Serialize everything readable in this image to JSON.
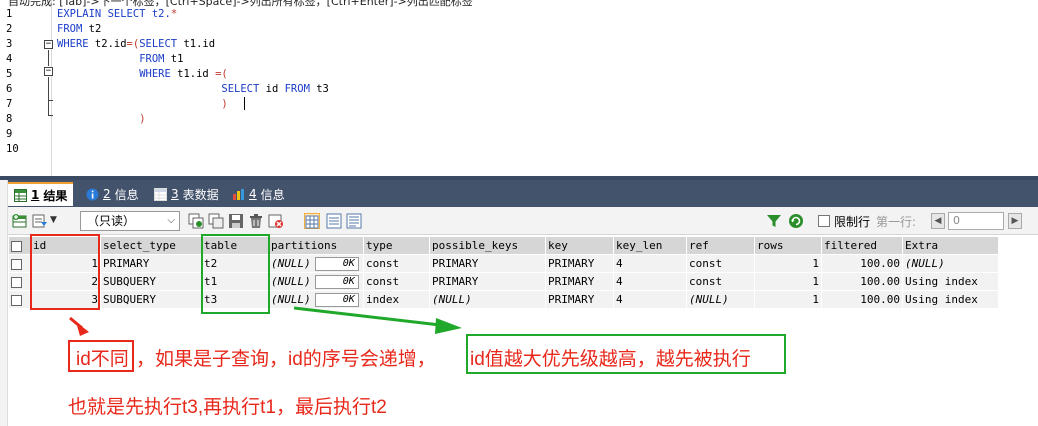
{
  "editor": {
    "hint": "自动完成: [Tab]->下一个标签，[Ctrl+Space]->列出所有标签，[Ctrl+Enter]->列出匹配标签",
    "lines": [
      {
        "no": "1",
        "indent": "",
        "tokens": [
          {
            "t": "EXPLAIN SELECT",
            "k": "kw"
          },
          {
            "t": " t2.",
            "k": "kw"
          },
          {
            "t": "*",
            "k": "pk"
          }
        ]
      },
      {
        "no": "2",
        "indent": "",
        "tokens": [
          {
            "t": "FROM",
            "k": "kw"
          },
          {
            "t": " t2",
            "k": ""
          }
        ]
      },
      {
        "no": "3",
        "indent": "",
        "tokens": [
          {
            "t": "WHERE",
            "k": "kw"
          },
          {
            "t": " t2.id",
            "k": ""
          },
          {
            "t": "=(",
            "k": "pk"
          },
          {
            "t": "SELECT",
            "k": "kw"
          },
          {
            "t": " t1.id",
            "k": ""
          }
        ]
      },
      {
        "no": "4",
        "indent": "             ",
        "tokens": [
          {
            "t": "FROM",
            "k": "kw"
          },
          {
            "t": " t1",
            "k": ""
          }
        ]
      },
      {
        "no": "5",
        "indent": "             ",
        "tokens": [
          {
            "t": "WHERE",
            "k": "kw"
          },
          {
            "t": " t1.id ",
            "k": ""
          },
          {
            "t": "=(",
            "k": "pk"
          }
        ]
      },
      {
        "no": "6",
        "indent": "                          ",
        "tokens": [
          {
            "t": "SELECT",
            "k": "kw"
          },
          {
            "t": " id ",
            "k": ""
          },
          {
            "t": "FROM",
            "k": "kw"
          },
          {
            "t": " t3",
            "k": ""
          }
        ]
      },
      {
        "no": "7",
        "indent": "                          ",
        "tokens": [
          {
            "t": ")",
            "k": "pk"
          }
        ]
      },
      {
        "no": "8",
        "indent": "             ",
        "tokens": [
          {
            "t": ")",
            "k": "pk"
          }
        ]
      },
      {
        "no": "9",
        "indent": "",
        "tokens": []
      },
      {
        "no": "10",
        "indent": "",
        "tokens": []
      }
    ]
  },
  "tabs": [
    {
      "num": "1",
      "label": "结果"
    },
    {
      "num": "2",
      "label": "信息"
    },
    {
      "num": "3",
      "label": "表数据"
    },
    {
      "num": "4",
      "label": "信息"
    }
  ],
  "toolbar": {
    "readonly_select": "（只读）",
    "limit_label": "限制行",
    "first_row_label": "第一行:",
    "first_row_value": "0"
  },
  "grid": {
    "columns": [
      "id",
      "select_type",
      "table",
      "partitions",
      "type",
      "possible_keys",
      "key",
      "key_len",
      "ref",
      "rows",
      "filtered",
      "Extra"
    ],
    "rows": [
      {
        "id": "1",
        "select_type": "PRIMARY",
        "table": "t2",
        "partitions": "(NULL)",
        "partitions_val": "0K",
        "type": "const",
        "possible_keys": "PRIMARY",
        "key": "PRIMARY",
        "key_len": "4",
        "ref": "const",
        "rows": "1",
        "filtered": "100.00",
        "Extra": "(NULL)"
      },
      {
        "id": "2",
        "select_type": "SUBQUERY",
        "table": "t1",
        "partitions": "(NULL)",
        "partitions_val": "0K",
        "type": "const",
        "possible_keys": "PRIMARY",
        "key": "PRIMARY",
        "key_len": "4",
        "ref": "const",
        "rows": "1",
        "filtered": "100.00",
        "Extra": "Using index"
      },
      {
        "id": "3",
        "select_type": "SUBQUERY",
        "table": "t3",
        "partitions": "(NULL)",
        "partitions_val": "0K",
        "type": "index",
        "possible_keys": "(NULL)",
        "key": "PRIMARY",
        "key_len": "4",
        "ref": "(NULL)",
        "rows": "1",
        "filtered": "100.00",
        "Extra": "Using index"
      }
    ]
  },
  "annotations": {
    "line1_part1": "id不同",
    "line1_part2": "，如果是子查询，id的序号会递增，",
    "line1_part3": "id值越大优先级越高，越先被执行",
    "line2": "也就是先执行t3,再执行t1，最后执行t2",
    "red": "#e8281a",
    "green": "#1fa829"
  }
}
